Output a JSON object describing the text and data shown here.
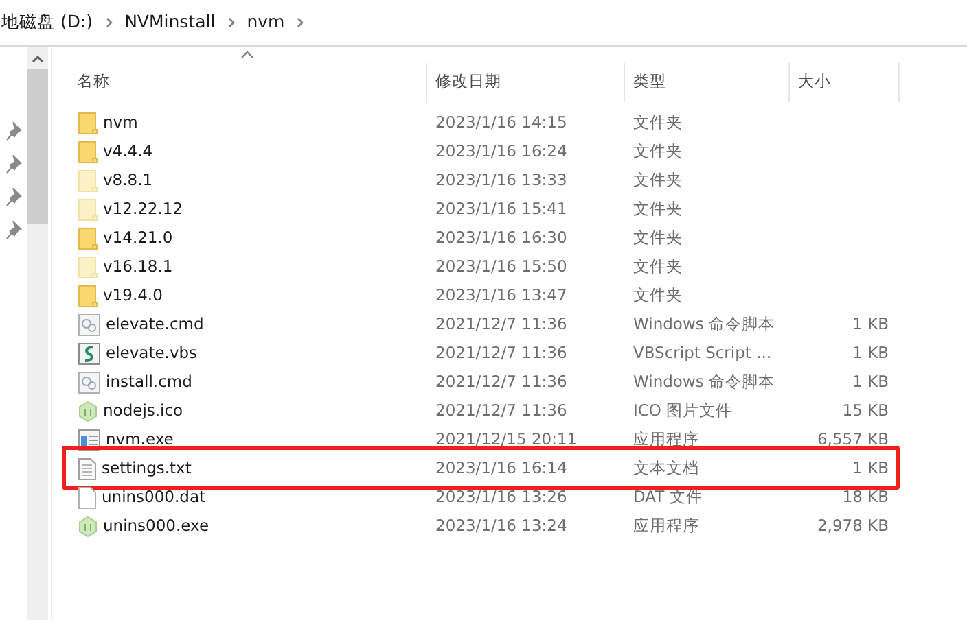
{
  "breadcrumb": [
    {
      "label": "地磁盘 (D:)"
    },
    {
      "label": "NVMinstall"
    },
    {
      "label": "nvm"
    }
  ],
  "columns": [
    {
      "label": "名称",
      "sorted": true
    },
    {
      "label": "修改日期",
      "sorted": false
    },
    {
      "label": "类型",
      "sorted": false
    },
    {
      "label": "大小",
      "sorted": false
    }
  ],
  "files": [
    {
      "name": "nvm",
      "kind": "folder",
      "hidden": false,
      "modified": "2023/1/16 14:15",
      "type": "文件夹",
      "outlined": false
    },
    {
      "name": "v4.4.4",
      "kind": "folder",
      "hidden": false,
      "modified": "2023/1/16 16:24",
      "type": "文件夹",
      "outlined": false
    },
    {
      "name": "v8.8.1",
      "kind": "folder",
      "hidden": true,
      "modified": "2023/1/16 13:33",
      "type": "文件夹",
      "outlined": false
    },
    {
      "name": "v12.22.12",
      "kind": "folder",
      "hidden": true,
      "modified": "2023/1/16 15:41",
      "type": "文件夹",
      "outlined": false
    },
    {
      "name": "v14.21.0",
      "kind": "folder",
      "hidden": false,
      "modified": "2023/1/16 16:30",
      "type": "文件夹",
      "outlined": false
    },
    {
      "name": "v16.18.1",
      "kind": "folder",
      "hidden": true,
      "modified": "2023/1/16 15:50",
      "type": "文件夹",
      "outlined": false
    },
    {
      "name": "v19.4.0",
      "kind": "folder",
      "hidden": false,
      "modified": "2023/1/16 13:47",
      "type": "文件夹",
      "outlined": false
    },
    {
      "name": "elevate.cmd",
      "kind": "cmd",
      "modified": "2021/12/7 11:36",
      "type": "Windows 命令脚本",
      "size": "1 KB",
      "outlined": false
    },
    {
      "name": "elevate.vbs",
      "kind": "vbs",
      "modified": "2021/12/7 11:36",
      "type": "VBScript Script ...",
      "size": "1 KB",
      "outlined": false
    },
    {
      "name": "install.cmd",
      "kind": "cmd",
      "modified": "2021/12/7 11:36",
      "type": "Windows 命令脚本",
      "size": "1 KB",
      "outlined": false
    },
    {
      "name": "nodejs.ico",
      "kind": "node",
      "modified": "2021/12/7 11:36",
      "type": "ICO 图片文件",
      "size": "15 KB",
      "outlined": false
    },
    {
      "name": "nvm.exe",
      "kind": "exe",
      "modified": "2021/12/15 20:11",
      "type": "应用程序",
      "size": "6,557 KB",
      "outlined": false
    },
    {
      "name": "settings.txt",
      "kind": "txt",
      "modified": "2023/1/16 16:14",
      "type": "文本文档",
      "size": "1 KB",
      "outlined": true
    },
    {
      "name": "unins000.dat",
      "kind": "dat",
      "modified": "2023/1/16 13:26",
      "type": "DAT 文件",
      "size": "18 KB",
      "outlined": false
    },
    {
      "name": "unins000.exe",
      "kind": "node",
      "modified": "2023/1/16 13:24",
      "type": "应用程序",
      "size": "2,978 KB",
      "outlined": false
    }
  ]
}
